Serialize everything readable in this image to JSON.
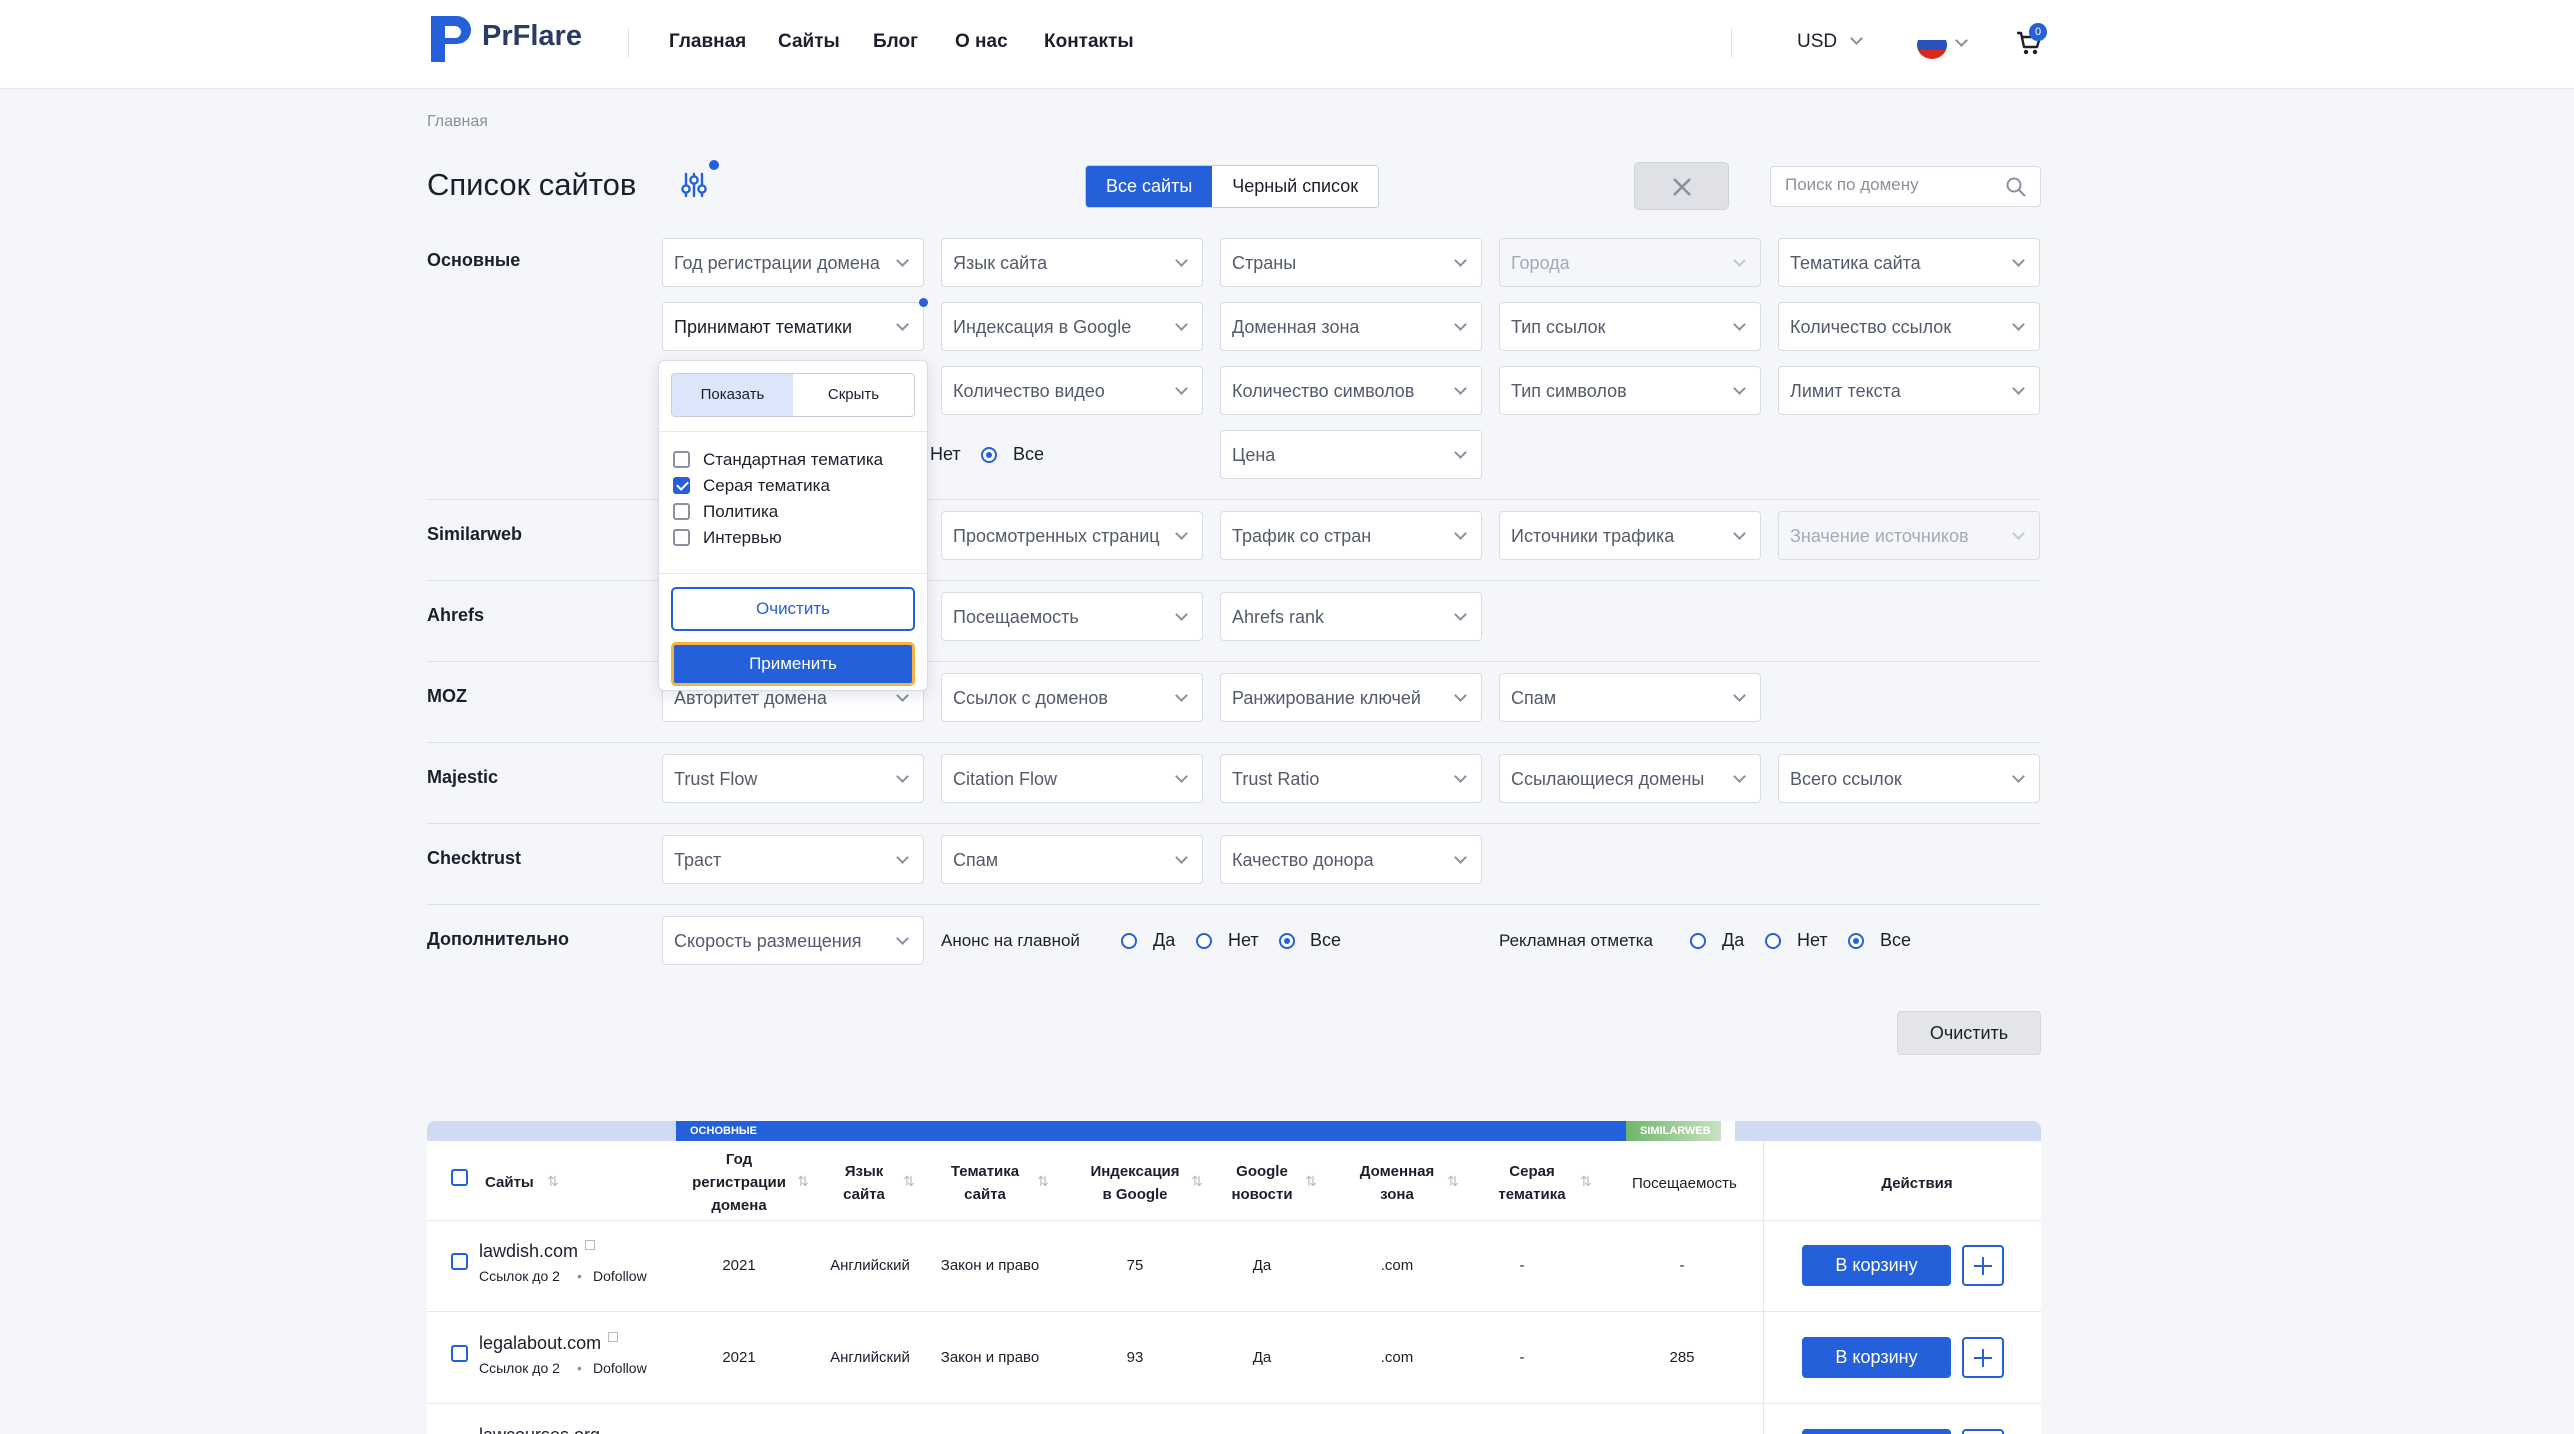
{
  "header": {
    "logo_text": "PrFlare",
    "nav": [
      "Главная",
      "Сайты",
      "Блог",
      "О нас",
      "Контакты"
    ],
    "currency": "USD",
    "cart_count": "0"
  },
  "breadcrumb": "Главная",
  "page_title": "Список сайтов",
  "segment": {
    "all": "Все сайты",
    "blacklist": "Черный список"
  },
  "search": {
    "placeholder": "Поиск по домену"
  },
  "sections": {
    "basic": "Основные",
    "similarweb": "Similarweb",
    "ahrefs": "Ahrefs",
    "moz": "MOZ",
    "majestic": "Majestic",
    "checktrust": "Checktrust",
    "extra": "Дополнительно"
  },
  "filters": {
    "reg_year": "Год регистрации домена",
    "language": "Язык сайта",
    "countries": "Страны",
    "cities": "Города",
    "topic": "Тематика сайта",
    "accept_topics": "Принимают тематики",
    "google_index": "Индексация в Google",
    "domain_zone": "Доменная зона",
    "link_type": "Тип ссылок",
    "link_count": "Количество ссылок",
    "video_count": "Количество видео",
    "char_count": "Количество символов",
    "char_type": "Тип символов",
    "text_limit": "Лимит текста",
    "price": "Цена",
    "pages_viewed": "Просмотренных страниц",
    "country_traffic": "Трафик со стран",
    "traffic_sources": "Источники трафика",
    "source_value": "Значение источников",
    "attendance": "Посещаемость",
    "ahrefs_rank": "Ahrefs rank",
    "domain_authority": "Авторитет домена",
    "links_from_domains": "Ссылок с доменов",
    "keyword_ranking": "Ранжирование ключей",
    "moz_spam": "Спам",
    "trust_flow": "Trust Flow",
    "citation_flow": "Citation Flow",
    "trust_ratio": "Trust Ratio",
    "ref_domains": "Ссылающиеся домены",
    "total_links": "Всего ссылок",
    "trust": "Траст",
    "ct_spam": "Спам",
    "donor_quality": "Качество донора",
    "placement_speed": "Скорость размещения"
  },
  "radios": {
    "no_partial": "Нет",
    "all": "Все",
    "announce_label": "Анонс на главной",
    "ad_label": "Рекламная отметка",
    "yes": "Да",
    "no": "Нет"
  },
  "clear_filters": "Очистить",
  "popover": {
    "show": "Показать",
    "hide": "Скрыть",
    "options": [
      {
        "label": "Стандартная тематика",
        "checked": false
      },
      {
        "label": "Серая тематика",
        "checked": true
      },
      {
        "label": "Политика",
        "checked": false
      },
      {
        "label": "Интервью",
        "checked": false
      }
    ],
    "clear": "Очистить",
    "apply": "Применить"
  },
  "table": {
    "group_basic": "ОСНОВНЫЕ",
    "group_similarweb": "SIMILARWEB",
    "columns": {
      "sites": "Сайты",
      "reg_year": [
        "Год",
        "регистрации",
        "домена"
      ],
      "language": [
        "Язык",
        "сайта"
      ],
      "topic": [
        "Тематика",
        "сайта"
      ],
      "google_index": [
        "Индексация",
        "в Google"
      ],
      "google_news": [
        "Google",
        "новости"
      ],
      "domain_zone": [
        "Доменная",
        "зона"
      ],
      "grey_topic": [
        "Серая",
        "тематика"
      ],
      "attendance": "Посещаемость",
      "actions": "Действия"
    },
    "rows": [
      {
        "site": "lawdish.com",
        "links": "Ссылок до 2",
        "follow": "Dofollow",
        "year": "2021",
        "lang": "Английский",
        "topic": "Закон и право",
        "index": "75",
        "news": "Да",
        "zone": ".com",
        "grey": "-",
        "traffic": "-"
      },
      {
        "site": "legalabout.com",
        "links": "Ссылок до 2",
        "follow": "Dofollow",
        "year": "2021",
        "lang": "Английский",
        "topic": "Закон и право",
        "index": "93",
        "news": "Да",
        "zone": ".com",
        "grey": "-",
        "traffic": "285"
      },
      {
        "site": "lawcourses.org"
      }
    ],
    "cart_button": "В корзину"
  },
  "colors": {
    "accent": "#2460d9",
    "apply_outline": "#f2b544"
  }
}
